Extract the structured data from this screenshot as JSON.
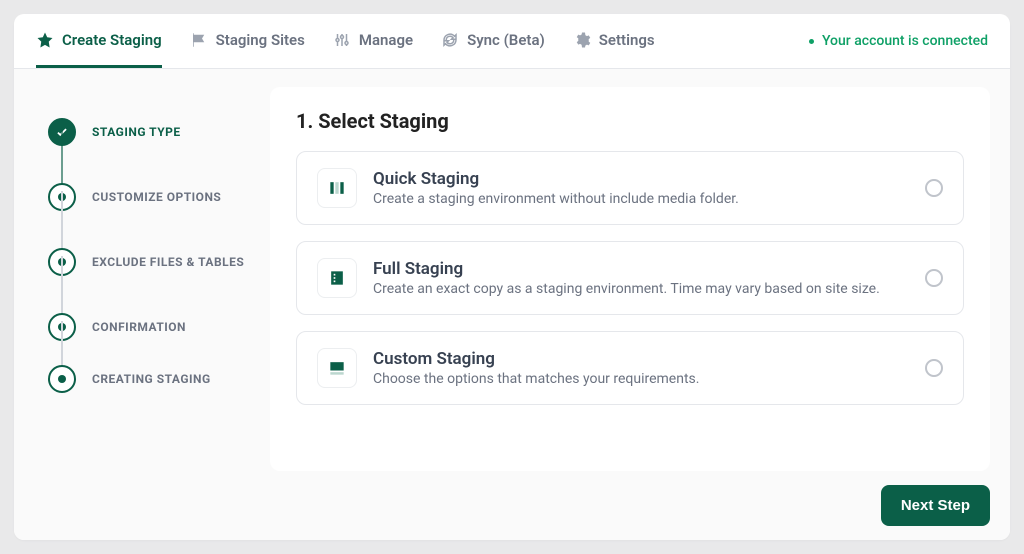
{
  "tabs": [
    {
      "id": "create",
      "label": "Create Staging",
      "active": true
    },
    {
      "id": "sites",
      "label": "Staging Sites",
      "active": false
    },
    {
      "id": "manage",
      "label": "Manage",
      "active": false
    },
    {
      "id": "sync",
      "label": "Sync (Beta)",
      "active": false
    },
    {
      "id": "settings",
      "label": "Settings",
      "active": false
    }
  ],
  "connection_status": "Your account is connected",
  "steps": [
    {
      "label": "STAGING TYPE",
      "state": "done"
    },
    {
      "label": "CUSTOMIZE OPTIONS",
      "state": "pending"
    },
    {
      "label": "EXCLUDE FILES & TABLES",
      "state": "pending"
    },
    {
      "label": "CONFIRMATION",
      "state": "pending"
    },
    {
      "label": "CREATING STAGING",
      "state": "pending"
    }
  ],
  "panel": {
    "heading": "1. Select Staging",
    "options": [
      {
        "id": "quick",
        "title": "Quick Staging",
        "desc": "Create a staging environment without include media folder.",
        "selected": false
      },
      {
        "id": "full",
        "title": "Full Staging",
        "desc": "Create an exact copy as a staging environment. Time may vary based on site size.",
        "selected": false
      },
      {
        "id": "custom",
        "title": "Custom Staging",
        "desc": "Choose the options that matches your requirements.",
        "selected": false
      }
    ]
  },
  "footer": {
    "next_button": "Next Step"
  },
  "colors": {
    "accent": "#0b5f48",
    "success": "#0ea066"
  }
}
